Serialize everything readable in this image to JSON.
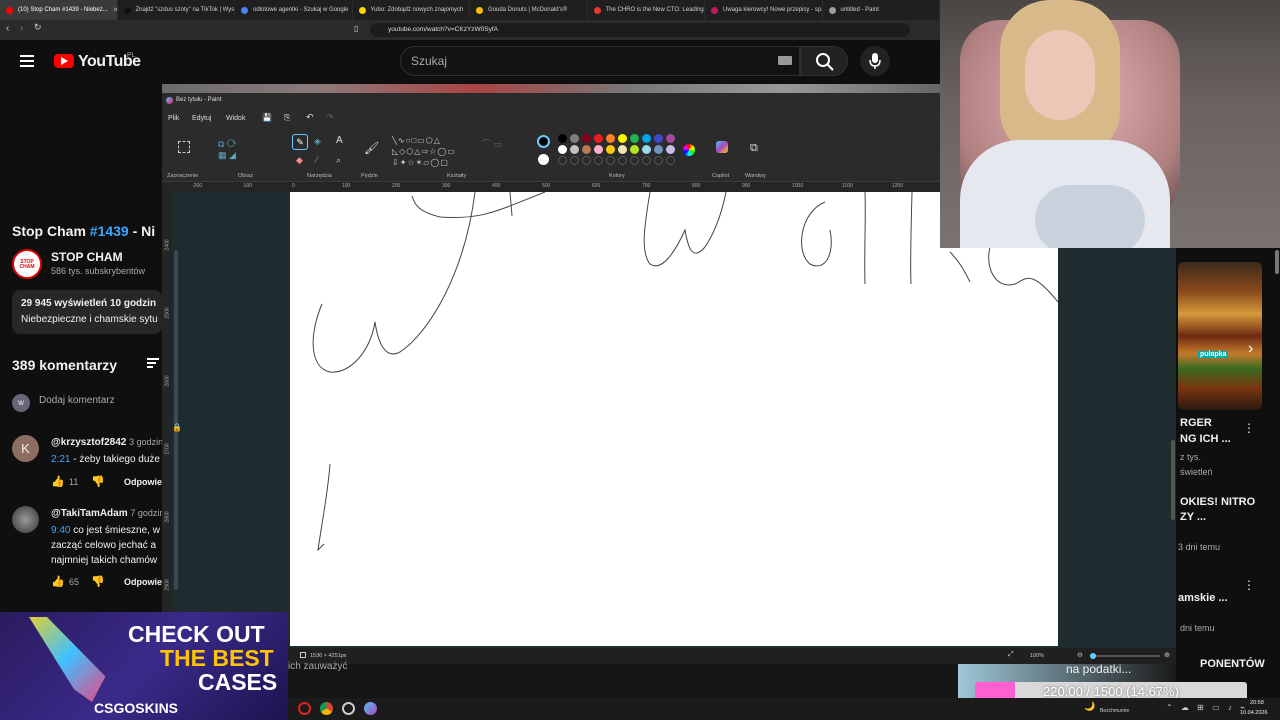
{
  "browser": {
    "tabs": [
      {
        "title": "(10) Stop Cham #1439 - Niebez...",
        "active": true,
        "color": "#ff0000"
      },
      {
        "title": "Znajdź \"szdus szoty\" na TikTok | Wyszu...",
        "active": false,
        "color": "#111111"
      },
      {
        "title": "odlotowe agentki - Szukaj w Google",
        "active": false,
        "color": "#4285f4"
      },
      {
        "title": "Yubo: Zdobądź nowych znajomych",
        "active": false,
        "color": "#ffd600"
      },
      {
        "title": "Gouda Donuts | McDonald's®",
        "active": false,
        "color": "#ffbc0d"
      },
      {
        "title": "The CHRO is the New CTO: Leading...",
        "active": false,
        "color": "#e53935"
      },
      {
        "title": "Uwaga kierowcy! Nowe przepisy - sp...",
        "active": false,
        "color": "#c2185b"
      },
      {
        "title": "untitled - Paint",
        "active": false,
        "color": "#9e9e9e"
      }
    ],
    "url": "youtube.com/watch?v=CKzYzW0SyfA"
  },
  "youtube": {
    "logo_text": "YouTube",
    "country": "PL",
    "search_placeholder": "Szukaj",
    "video_title_prefix": "Stop Cham ",
    "video_title_tag": "#1439",
    "video_title_suffix": " - Ni",
    "channel_name": "STOP CHAM",
    "channel_avatar_text": "STOP CHAM",
    "subscribers": "586 tys. subskrybentów",
    "views": "29 945 wyświetleń  10 godzin",
    "desc": "Niebezpieczne i chamskie sytu",
    "comments_count": "389 komentarzy",
    "add_comment": "Dodaj komentarz",
    "comments": [
      {
        "avatar": "K",
        "author": "@krzysztof2842",
        "time": "3 godzin",
        "link": "2:21",
        "text": " - żeby takiego duże",
        "likes": "11",
        "reply": "Odpowie"
      },
      {
        "avatar": "",
        "author": "@TakiTamAdam",
        "time": "7 godzin",
        "link": "9:40",
        "text": " co jest śmieszne, w",
        "line2": "zacząć celowo jechać a",
        "line3": "najmniej takich chamów",
        "likes": "65",
        "reply": "Odpowie"
      }
    ],
    "right_col": {
      "thumb_label": "pułapka",
      "items": [
        {
          "line1": "RGER",
          "line2": "NG ICH ..."
        },
        {
          "line1": "z tys.",
          "line2": "świetleń"
        },
        {
          "line1": "OKIES! NITRO",
          "line2": "ZY ..."
        },
        {
          "line1": "3 dni temu",
          "line2": ""
        },
        {
          "line1": "amskie ...",
          "line2": ""
        },
        {
          "line1": "dni temu",
          "line2": ""
        },
        {
          "line1": "PONENTÓW",
          "line2": ""
        }
      ]
    },
    "bottom_text": "ich zauważyć",
    "overlay_promo": "na podatki..."
  },
  "paint": {
    "title": "Bez tytułu - Paint",
    "menu": [
      "Plik",
      "Edytuj",
      "Widok"
    ],
    "groups": [
      "Zaznaczenie",
      "Obraz",
      "Narzędzia",
      "Pędzle",
      "Kształty",
      "Kolory",
      "Copilot",
      "Warstwy"
    ],
    "ruler_top": [
      "-200",
      "-100",
      "0",
      "100",
      "200",
      "300",
      "400",
      "500",
      "600",
      "700",
      "800",
      "900",
      "1000",
      "1100",
      "1200"
    ],
    "ruler_left": [
      "2400",
      "2500",
      "2600",
      "2700",
      "2800",
      "2900",
      "3000"
    ],
    "canvas_size": "1536 × 4251px",
    "zoom": "100%",
    "palette": [
      "#000000",
      "#7f7f7f",
      "#880015",
      "#ed1c24",
      "#ff7f27",
      "#fff200",
      "#22b14c",
      "#00a2e8",
      "#3f48cc",
      "#a349a4",
      "#ffffff",
      "#c3c3c3",
      "#b97a57",
      "#ffaec9",
      "#ffc90e",
      "#efe4b0",
      "#b5e61d",
      "#99d9ea",
      "#7092be",
      "#c8bfe7"
    ]
  },
  "ad": {
    "line1": "CHECK OUT",
    "line2": "THE BEST",
    "line3": "CASES",
    "brand": "CSGOSKINS"
  },
  "donation": {
    "text": "220.00 / 1500 (14.67%)",
    "fraction": 0.1467
  },
  "taskbar": {
    "status": "Bezchmurnie",
    "time": "20:58",
    "date": "10.04.2026"
  }
}
